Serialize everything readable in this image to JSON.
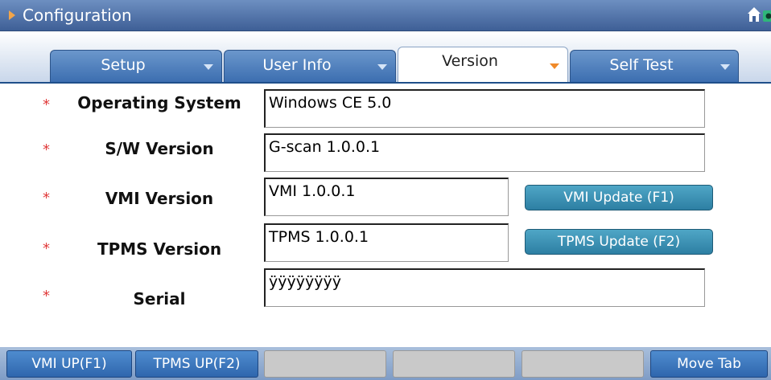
{
  "window": {
    "title": "Configuration",
    "icons": [
      "home-icon",
      "camera-icon"
    ]
  },
  "tabs": [
    {
      "label": "Setup",
      "active": false
    },
    {
      "label": "User Info",
      "active": false
    },
    {
      "label": "Version",
      "active": true
    },
    {
      "label": "Self Test",
      "active": false
    }
  ],
  "form": {
    "required_marker": "*",
    "os": {
      "label": "Operating System",
      "value": "Windows CE 5.0"
    },
    "sw": {
      "label": "S/W Version",
      "value": "G-scan 1.0.0.1"
    },
    "vmi": {
      "label": "VMI Version",
      "value": "VMI 1.0.0.1",
      "button": "VMI Update (F1)"
    },
    "tpms": {
      "label": "TPMS Version",
      "value": "TPMS 1.0.0.1",
      "button": "TPMS Update (F2)"
    },
    "serial": {
      "label": "Serial",
      "value": "ÿÿÿÿÿÿÿÿ"
    }
  },
  "function_keys": {
    "f1": "VMI UP(F1)",
    "f2": "TPMS UP(F2)",
    "f3": "",
    "f4": "",
    "f5": "",
    "f6": "Move Tab"
  },
  "colors": {
    "title_bar": "#3e5f96",
    "tab_inactive": "#3c6eb0",
    "required_star": "#e03a3a",
    "update_button": "#2d7fa3",
    "fkey_active": "#2f66ad",
    "fkey_disabled": "#c9c9c9"
  }
}
